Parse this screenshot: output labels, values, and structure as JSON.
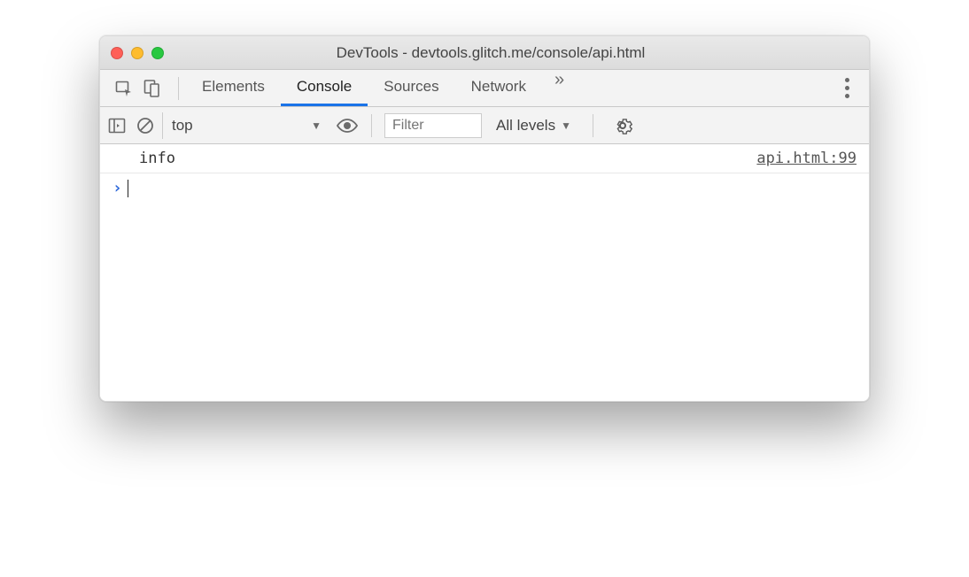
{
  "window": {
    "title": "DevTools - devtools.glitch.me/console/api.html"
  },
  "tabs": {
    "items": [
      "Elements",
      "Console",
      "Sources",
      "Network"
    ],
    "active": "Console"
  },
  "filterbar": {
    "context": "top",
    "filter_placeholder": "Filter",
    "levels_label": "All levels"
  },
  "console": {
    "rows": [
      {
        "message": "info",
        "source": "api.html:99"
      }
    ]
  }
}
